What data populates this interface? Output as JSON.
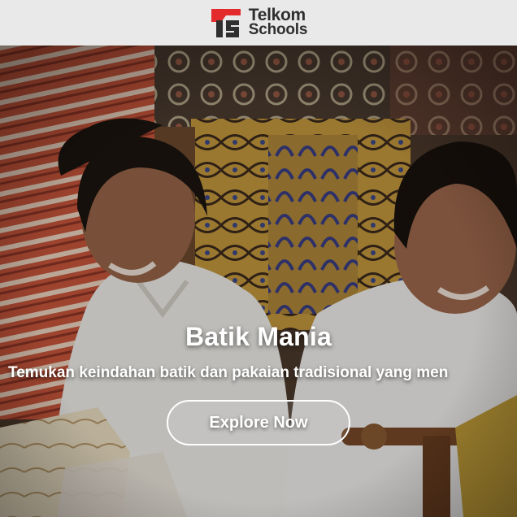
{
  "brand": {
    "line1": "Telkom",
    "line2": "Schools",
    "colors": {
      "red": "#e32b2b",
      "dark": "#2f2f2f"
    }
  },
  "hero": {
    "title": "Batik Mania",
    "subtitle": "Temukan keindahan batik dan pakaian tradisional yang men",
    "cta_label": "Explore Now"
  }
}
